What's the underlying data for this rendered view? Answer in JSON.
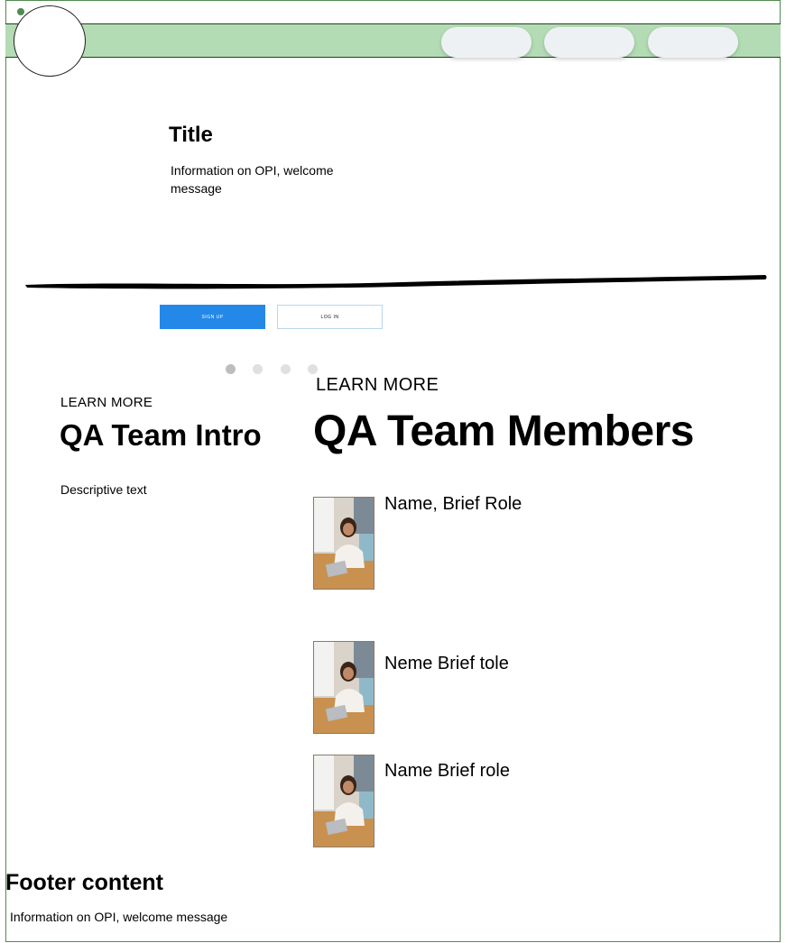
{
  "header": {
    "nav_items": [
      "",
      "",
      ""
    ]
  },
  "hero": {
    "title": "Title",
    "text": "Information on OPI, welcome message"
  },
  "buttons": {
    "signup_label": "SIGN UP",
    "login_label": "LOG IN"
  },
  "carousel": {
    "dot_count": 4,
    "active_index": 0
  },
  "intro": {
    "kicker": "LEARN MORE",
    "title": "QA Team Intro",
    "text": "Descriptive text"
  },
  "members": {
    "kicker": "LEARN MORE",
    "title": "QA Team Members",
    "items": [
      {
        "name": "Name, Brief Role"
      },
      {
        "name": "Neme Brief tole"
      },
      {
        "name": "Name Brief role"
      }
    ]
  },
  "footer": {
    "title": "Footer content",
    "text": "Information on OPI, welcome message"
  },
  "colors": {
    "nav_band": "#b3dcb4",
    "frame": "#4f8a4f",
    "primary_button": "#2488e8"
  }
}
